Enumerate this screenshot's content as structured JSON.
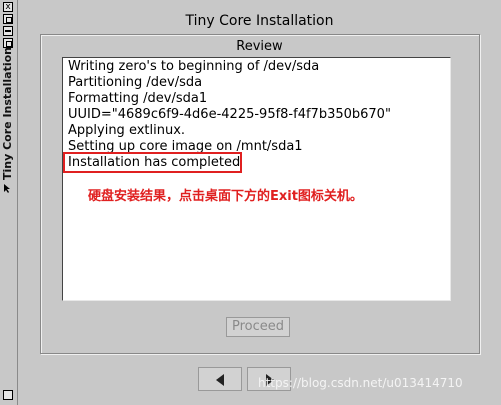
{
  "window": {
    "title": "Tiny Core Installation",
    "side_title": "Tiny Core Installation"
  },
  "review": {
    "label": "Review",
    "lines": [
      "Writing zero's to beginning of /dev/sda",
      "Partitioning /dev/sda",
      "Formatting /dev/sda1",
      "UUID=\"4689c6f9-4d6e-4225-95f8-f4f7b350b670\"",
      "Applying extlinux.",
      "Setting up core image on /mnt/sda1",
      "Installation has completed"
    ]
  },
  "annotation": {
    "text": "硬盘安装结果，点击桌面下方的Exit图标关机。",
    "color": "#e02020"
  },
  "buttons": {
    "proceed_label": "Proceed",
    "close_glyph": "x"
  },
  "watermark": "https://blog.csdn.net/u013414710"
}
